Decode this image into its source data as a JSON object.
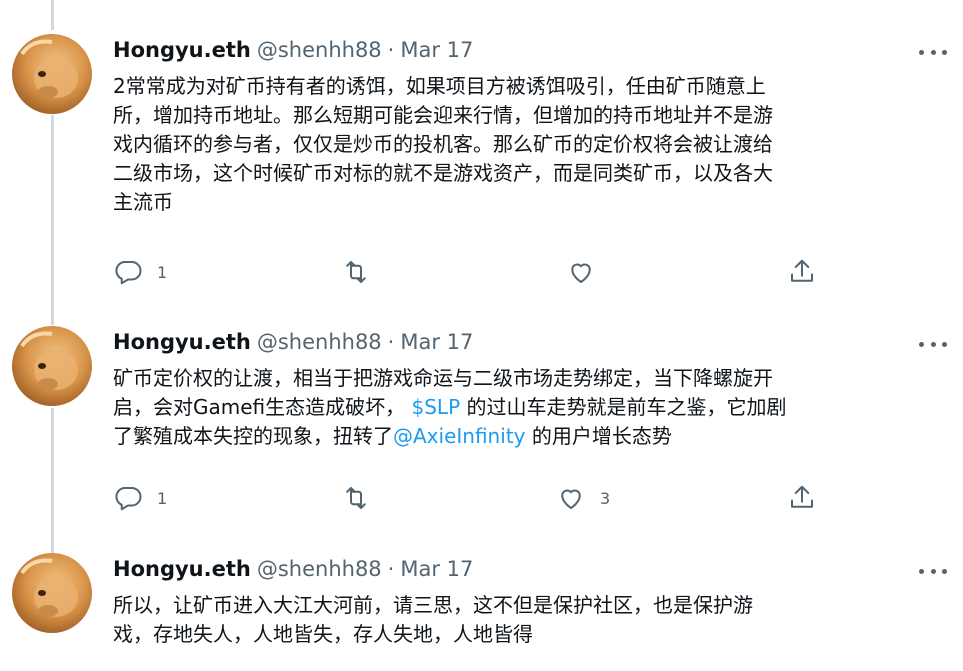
{
  "tweets": [
    {
      "name": "Hongyu.eth",
      "handle": "@shenhh88",
      "sep": "·",
      "date": "Mar 17",
      "segments": [
        {
          "t": "2常常成为对矿币持有者的诱饵，如果项目方被诱饵吸引，任由矿币随意上"
        },
        {
          "br": true
        },
        {
          "t": "所，增加持币地址。那么短期可能会迎来行情，但增加的持币地址并不是游"
        },
        {
          "br": true
        },
        {
          "t": "戏内循环的参与者，仅仅是炒币的投机客。那么矿币的定价权将会被让渡给"
        },
        {
          "br": true
        },
        {
          "t": "二级市场，这个时候矿币对标的就不是游戏资产，而是同类矿币，以及各大"
        },
        {
          "br": true
        },
        {
          "t": "主流币"
        }
      ],
      "reply_count": "1",
      "retweet_count": "",
      "like_count": ""
    },
    {
      "name": "Hongyu.eth",
      "handle": "@shenhh88",
      "sep": "·",
      "date": "Mar 17",
      "segments": [
        {
          "t": "矿币定价权的让渡，相当于把游戏命运与二级市场走势绑定，当下降螺旋开"
        },
        {
          "br": true
        },
        {
          "t": "启，会对Gamefi生态造成破坏， "
        },
        {
          "t": "$SLP",
          "link": true
        },
        {
          "t": " 的过山车走势就是前车之鉴，它加剧"
        },
        {
          "br": true
        },
        {
          "t": "了繁殖成本失控的现象，扭转了"
        },
        {
          "t": "@AxieInfinity",
          "link": true
        },
        {
          "t": " 的用户增长态势"
        }
      ],
      "reply_count": "1",
      "retweet_count": "",
      "like_count": "3"
    },
    {
      "name": "Hongyu.eth",
      "handle": "@shenhh88",
      "sep": "·",
      "date": "Mar 17",
      "segments": [
        {
          "t": "所以，让矿币进入大江大河前，请三思，这不但是保护社区，也是保护游"
        },
        {
          "br": true
        },
        {
          "t": "戏，存地失人，人地皆失，存人失地，人地皆得"
        }
      ],
      "reply_count": "",
      "retweet_count": "",
      "like_count": ""
    }
  ],
  "icons": {
    "reply": "reply-icon",
    "retweet": "retweet-icon",
    "like": "like-icon",
    "share": "share-icon",
    "more": "more-icon"
  },
  "colors": {
    "link": "#1d9bf0",
    "secondary": "#536471",
    "thread_line": "#cfd9de"
  }
}
